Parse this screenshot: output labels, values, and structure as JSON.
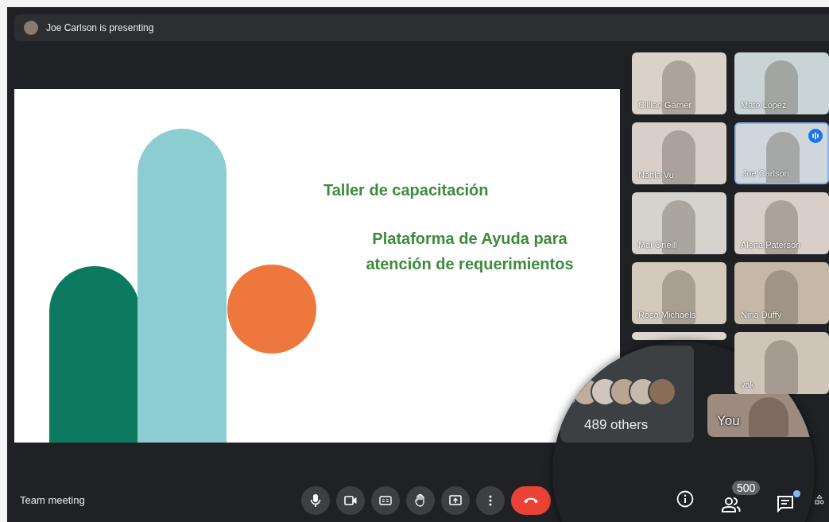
{
  "presenter_bar": {
    "text": "Joe Carlson is presenting"
  },
  "slide": {
    "title": "Taller de capacitación",
    "subtitle_lines": [
      "Plataforma de Ayuda para",
      "atención de requerimientos"
    ]
  },
  "participants": [
    {
      "name": "Cillian Garner",
      "speaking": false
    },
    {
      "name": "Mato Lopez",
      "speaking": false
    },
    {
      "name": "Nahla Vu",
      "speaking": false
    },
    {
      "name": "Joe Carlson",
      "speaking": true
    },
    {
      "name": "Mai Oneill",
      "speaking": false
    },
    {
      "name": "Alena Paterson",
      "speaking": false
    },
    {
      "name": "Rosa Michaels",
      "speaking": false
    },
    {
      "name": "Nina Duffy",
      "speaking": false
    },
    {
      "speaking": false
    },
    {
      "name": "vak",
      "speaking": false
    }
  ],
  "magnifier": {
    "others_label": "489 others",
    "self_label": "You",
    "participant_count": "500",
    "chat_unread": true
  },
  "meeting_title": "Team meeting",
  "controls": [
    {
      "kind": "mic"
    },
    {
      "kind": "camera"
    },
    {
      "kind": "captions"
    },
    {
      "kind": "hand"
    },
    {
      "kind": "present"
    },
    {
      "kind": "more"
    },
    {
      "kind": "hangup"
    }
  ]
}
